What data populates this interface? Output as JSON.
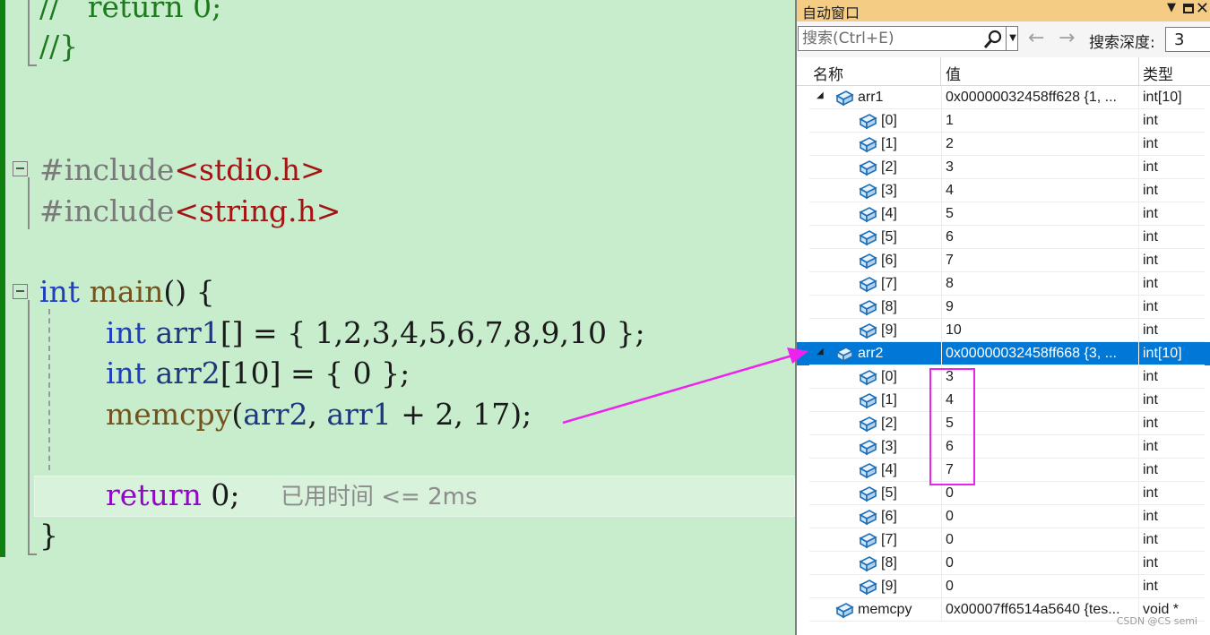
{
  "editor": {
    "lines": {
      "l1": {
        "comment": "//",
        "ret": "return",
        "tail": " 0;"
      },
      "l2": {
        "text": "//}"
      },
      "inc1": {
        "pp": "#include",
        "lib": "<stdio.h>"
      },
      "inc2": {
        "pp": "#include",
        "lib": "<string.h>"
      },
      "main": {
        "kw": "int",
        "fn": "main",
        "rest": "() {"
      },
      "arr1": {
        "kw": "int",
        "name": "arr1",
        "rest": "[] = { 1,2,3,4,5,6,7,8,9,10 };"
      },
      "arr2": {
        "kw": "int",
        "name": "arr2",
        "rest": "[10] = { 0 };"
      },
      "memcpy": {
        "fn": "memcpy",
        "p1": "(",
        "a": "arr2",
        "p2": ", ",
        "b": "arr1",
        "rest": " + 2, 17);"
      },
      "ret": {
        "kw": "return",
        "rest": " 0;"
      },
      "close": {
        "text": "}"
      }
    },
    "elapsed": "已用时间 <= 2ms"
  },
  "autos": {
    "title": "自动窗口",
    "search_placeholder": "搜索(Ctrl+E)",
    "depth_label": "搜索深度:",
    "depth_value": "3",
    "columns": {
      "name": "名称",
      "value": "值",
      "type": "类型"
    },
    "rows": [
      {
        "name": "arr1",
        "value": "0x00000032458ff628 {1, ...",
        "type": "int[10]"
      },
      {
        "name": "[0]",
        "value": "1",
        "type": "int"
      },
      {
        "name": "[1]",
        "value": "2",
        "type": "int"
      },
      {
        "name": "[2]",
        "value": "3",
        "type": "int"
      },
      {
        "name": "[3]",
        "value": "4",
        "type": "int"
      },
      {
        "name": "[4]",
        "value": "5",
        "type": "int"
      },
      {
        "name": "[5]",
        "value": "6",
        "type": "int"
      },
      {
        "name": "[6]",
        "value": "7",
        "type": "int"
      },
      {
        "name": "[7]",
        "value": "8",
        "type": "int"
      },
      {
        "name": "[8]",
        "value": "9",
        "type": "int"
      },
      {
        "name": "[9]",
        "value": "10",
        "type": "int"
      },
      {
        "name": "arr2",
        "value": "0x00000032458ff668 {3, ...",
        "type": "int[10]"
      },
      {
        "name": "[0]",
        "value": "3",
        "type": "int"
      },
      {
        "name": "[1]",
        "value": "4",
        "type": "int"
      },
      {
        "name": "[2]",
        "value": "5",
        "type": "int"
      },
      {
        "name": "[3]",
        "value": "6",
        "type": "int"
      },
      {
        "name": "[4]",
        "value": "7",
        "type": "int"
      },
      {
        "name": "[5]",
        "value": "0",
        "type": "int"
      },
      {
        "name": "[6]",
        "value": "0",
        "type": "int"
      },
      {
        "name": "[7]",
        "value": "0",
        "type": "int"
      },
      {
        "name": "[8]",
        "value": "0",
        "type": "int"
      },
      {
        "name": "[9]",
        "value": "0",
        "type": "int"
      },
      {
        "name": "memcpy",
        "value": "0x00007ff6514a5640 {tes...",
        "type": "void *"
      }
    ]
  },
  "watermark": "CSDN @CS semi",
  "colors": {
    "selection": "#0078d7",
    "annotation": "#ee22ee",
    "editor_bg": "#c7edcc",
    "title_bar": "#f5cc84"
  },
  "icons": [
    "search-icon",
    "back-arrow-icon",
    "forward-arrow-icon",
    "variable-icon",
    "expand-triangle-icon",
    "close-icon"
  ]
}
